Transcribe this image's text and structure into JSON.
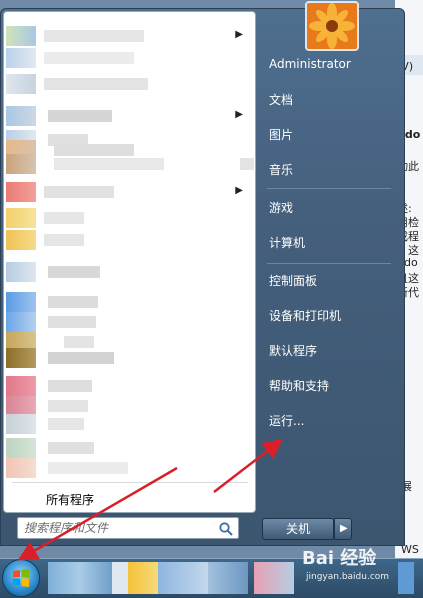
{
  "user": {
    "name": "Administrator"
  },
  "left_pane": {
    "all_programs_label": "所有程序",
    "search_placeholder": "搜索程序和文件"
  },
  "right_pane": {
    "items": [
      {
        "label": "文档"
      },
      {
        "label": "图片"
      },
      {
        "label": "音乐"
      },
      {
        "label": "游戏"
      },
      {
        "label": "计算机"
      },
      {
        "label": "控制面板"
      },
      {
        "label": "设备和打印机"
      },
      {
        "label": "默认程序"
      },
      {
        "label": "帮助和支持"
      },
      {
        "label": "运行..."
      }
    ]
  },
  "shutdown": {
    "label": "关机"
  },
  "background_window": {
    "texts": [
      "(V)",
      "ndo",
      "动此",
      "述:",
      "用检",
      "成程",
      "，这",
      "ndo",
      "且这",
      "新代",
      "展",
      "WS"
    ]
  },
  "watermark": {
    "brand": "Bai 经验",
    "url": "jingyan.baidu.com"
  },
  "colors": {
    "annotation_arrow": "#d9202a",
    "menu_bg": "#4a6989"
  },
  "icons": {
    "start": "windows-orb-icon",
    "search": "magnifier-icon",
    "submenu": "triangle-right-icon",
    "shutdown_more": "triangle-right-icon"
  }
}
